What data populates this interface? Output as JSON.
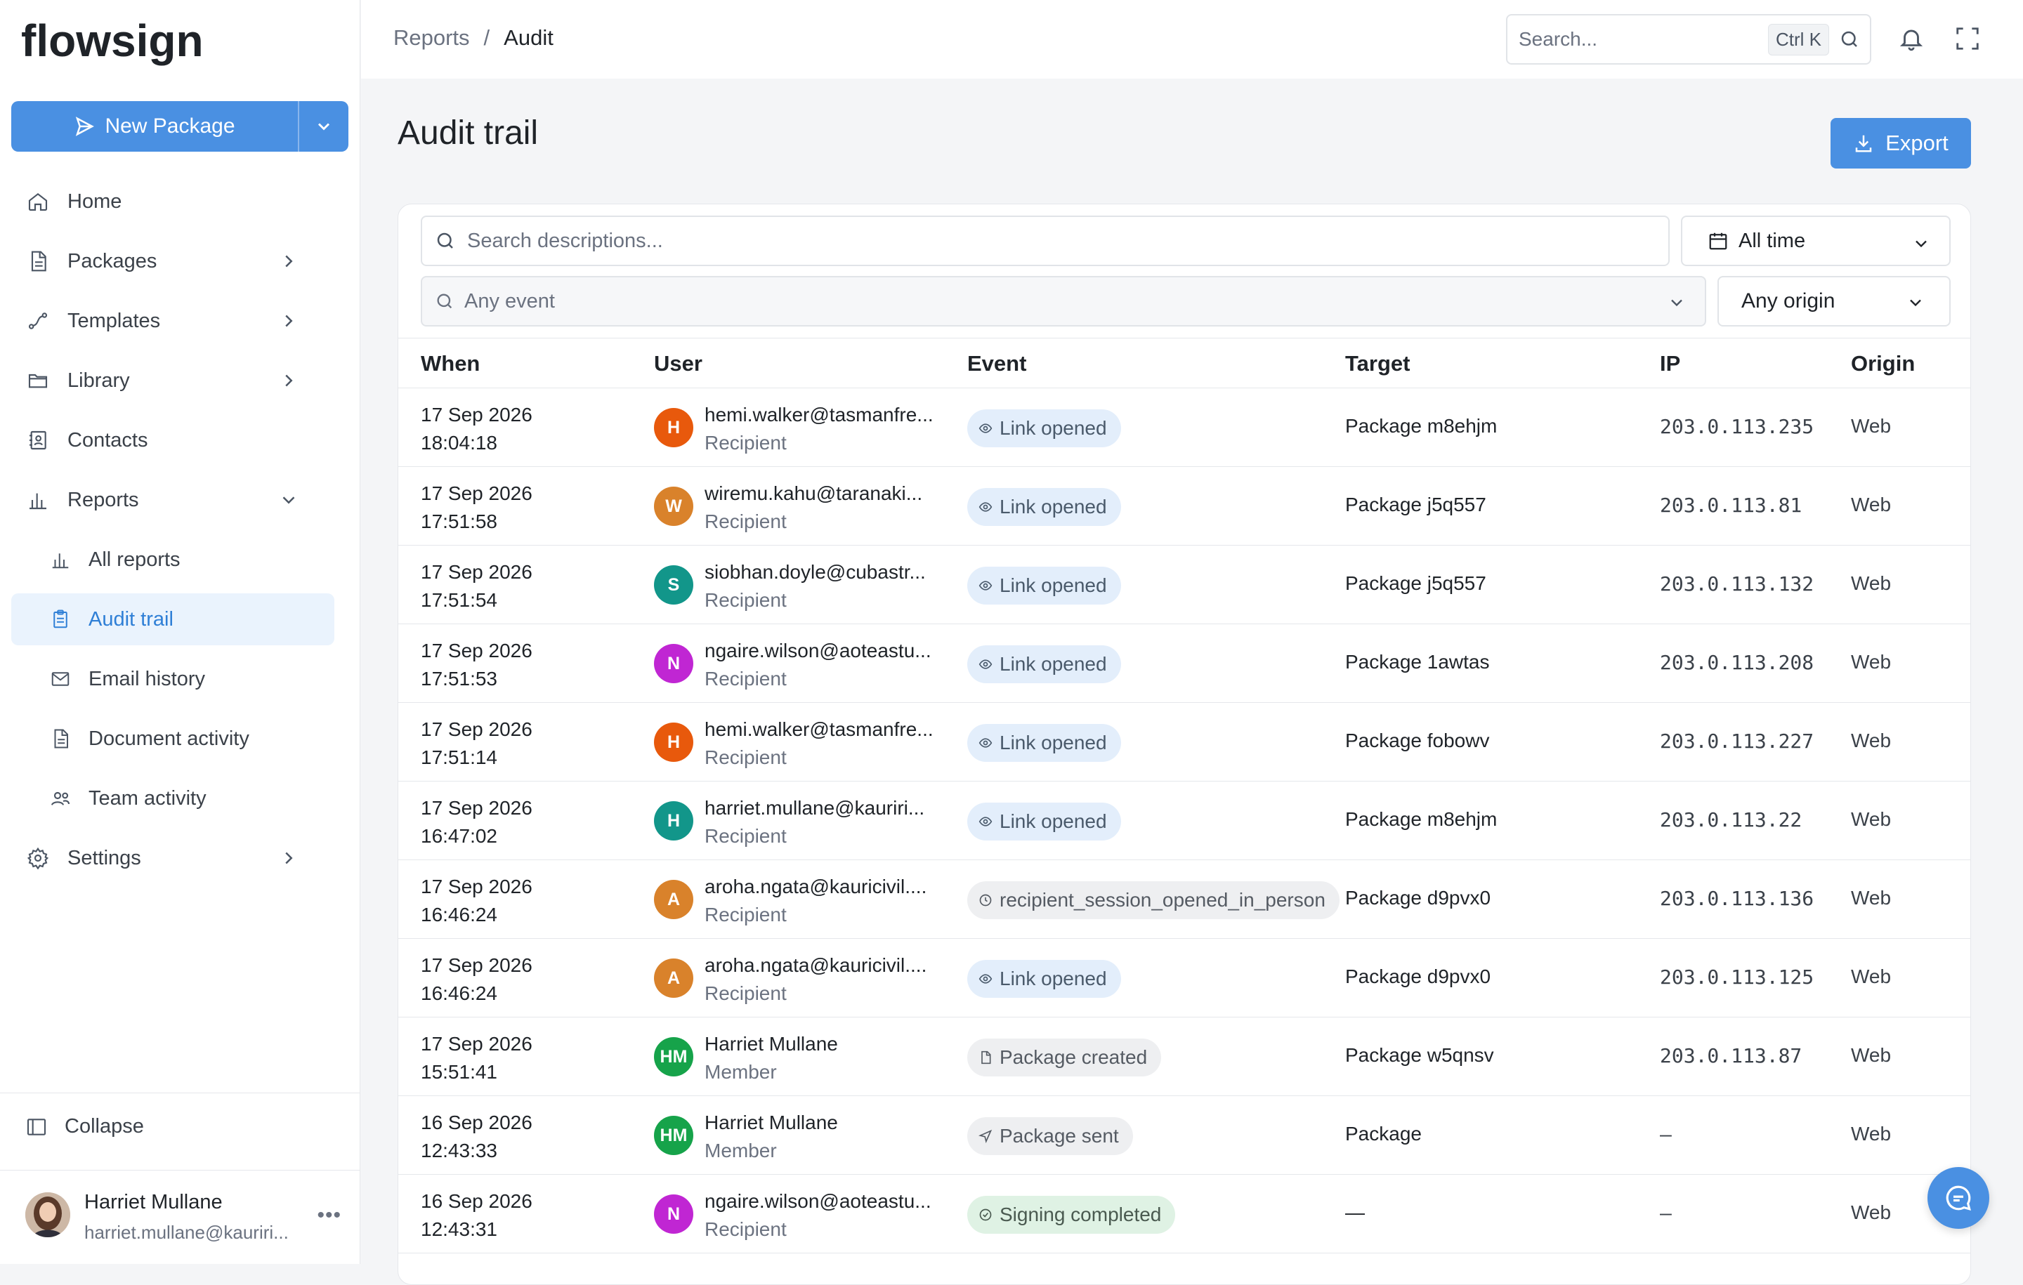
{
  "app": {
    "logo_text": "flowsign",
    "brand_color": "#4a90e2"
  },
  "sidebar": {
    "new_package_label": "New Package",
    "items": [
      {
        "label": "Home",
        "icon": "home-icon"
      },
      {
        "label": "Packages",
        "icon": "document-icon"
      },
      {
        "label": "Templates",
        "icon": "route-icon"
      },
      {
        "label": "Library",
        "icon": "folder-icon"
      },
      {
        "label": "Contacts",
        "icon": "contact-book-icon"
      },
      {
        "label": "Reports",
        "icon": "bar-chart-icon"
      },
      {
        "label": "All reports",
        "icon": "bar-chart-icon"
      },
      {
        "label": "Audit trail",
        "icon": "clipboard-icon"
      },
      {
        "label": "Email history",
        "icon": "mail-icon"
      },
      {
        "label": "Document activity",
        "icon": "document-icon"
      },
      {
        "label": "Team activity",
        "icon": "users-icon"
      },
      {
        "label": "Settings",
        "icon": "gear-icon"
      }
    ],
    "collapse_label": "Collapse",
    "user": {
      "name": "Harriet Mullane",
      "email": "harriet.mullane@kauriri..."
    }
  },
  "topbar": {
    "breadcrumb": [
      "Reports",
      "Audit"
    ],
    "search_placeholder": "Search...",
    "search_shortcut": "Ctrl K"
  },
  "main": {
    "title": "Audit trail",
    "export_label": "Export",
    "filters": {
      "search_placeholder": "Search descriptions...",
      "time_value": "All time",
      "event_placeholder": "Any event",
      "origin_value": "Any origin"
    },
    "columns": [
      "When",
      "User",
      "Event",
      "Target",
      "IP",
      "Origin"
    ],
    "rows": [
      {
        "date": "17 Sep 2026",
        "time": "18:04:18",
        "initials": "H",
        "avatar_color": "#e8590c",
        "user": "hemi.walker@tasmanfre...",
        "role": "Recipient",
        "event": "Link opened",
        "event_kind": "blue",
        "event_icon": "eye-icon",
        "target": "Package m8ehjm",
        "ip": "203.0.113.235",
        "origin": "Web"
      },
      {
        "date": "17 Sep 2026",
        "time": "17:51:58",
        "initials": "W",
        "avatar_color": "#d9822b",
        "user": "wiremu.kahu@taranaki...",
        "role": "Recipient",
        "event": "Link opened",
        "event_kind": "blue",
        "event_icon": "eye-icon",
        "target": "Package j5q557",
        "ip": "203.0.113.81",
        "origin": "Web"
      },
      {
        "date": "17 Sep 2026",
        "time": "17:51:54",
        "initials": "S",
        "avatar_color": "#12968a",
        "user": "siobhan.doyle@cubastr...",
        "role": "Recipient",
        "event": "Link opened",
        "event_kind": "blue",
        "event_icon": "eye-icon",
        "target": "Package j5q557",
        "ip": "203.0.113.132",
        "origin": "Web"
      },
      {
        "date": "17 Sep 2026",
        "time": "17:51:53",
        "initials": "N",
        "avatar_color": "#c026d3",
        "user": "ngaire.wilson@aoteastu...",
        "role": "Recipient",
        "event": "Link opened",
        "event_kind": "blue",
        "event_icon": "eye-icon",
        "target": "Package 1awtas",
        "ip": "203.0.113.208",
        "origin": "Web"
      },
      {
        "date": "17 Sep 2026",
        "time": "17:51:14",
        "initials": "H",
        "avatar_color": "#e8590c",
        "user": "hemi.walker@tasmanfre...",
        "role": "Recipient",
        "event": "Link opened",
        "event_kind": "blue",
        "event_icon": "eye-icon",
        "target": "Package fobowv",
        "ip": "203.0.113.227",
        "origin": "Web"
      },
      {
        "date": "17 Sep 2026",
        "time": "16:47:02",
        "initials": "H",
        "avatar_color": "#12968a",
        "user": "harriet.mullane@kauriri...",
        "role": "Recipient",
        "event": "Link opened",
        "event_kind": "blue",
        "event_icon": "eye-icon",
        "target": "Package m8ehjm",
        "ip": "203.0.113.22",
        "origin": "Web"
      },
      {
        "date": "17 Sep 2026",
        "time": "16:46:24",
        "initials": "A",
        "avatar_color": "#d9822b",
        "user": "aroha.ngata@kauricivil....",
        "role": "Recipient",
        "event": "recipient_session_opened_in_person",
        "event_kind": "gray",
        "event_icon": "clock-icon",
        "target": "Package d9pvx0",
        "ip": "203.0.113.136",
        "origin": "Web"
      },
      {
        "date": "17 Sep 2026",
        "time": "16:46:24",
        "initials": "A",
        "avatar_color": "#d9822b",
        "user": "aroha.ngata@kauricivil....",
        "role": "Recipient",
        "event": "Link opened",
        "event_kind": "blue",
        "event_icon": "eye-icon",
        "target": "Package d9pvx0",
        "ip": "203.0.113.125",
        "origin": "Web"
      },
      {
        "date": "17 Sep 2026",
        "time": "15:51:41",
        "initials": "HM",
        "avatar_color": "#16a34a",
        "user": "Harriet Mullane",
        "role": "Member",
        "event": "Package created",
        "event_kind": "gray",
        "event_icon": "document-icon",
        "target": "Package w5qnsv",
        "ip": "203.0.113.87",
        "origin": "Web"
      },
      {
        "date": "16 Sep 2026",
        "time": "12:43:33",
        "initials": "HM",
        "avatar_color": "#16a34a",
        "user": "Harriet Mullane",
        "role": "Member",
        "event": "Package sent",
        "event_kind": "gray",
        "event_icon": "send-icon",
        "target": "Package",
        "ip": "—",
        "origin": "Web"
      },
      {
        "date": "16 Sep 2026",
        "time": "12:43:31",
        "initials": "N",
        "avatar_color": "#c026d3",
        "user": "ngaire.wilson@aoteastu...",
        "role": "Recipient",
        "event": "Signing completed",
        "event_kind": "green",
        "event_icon": "check-circle-icon",
        "target": "—",
        "ip": "—",
        "origin": "Web"
      }
    ]
  }
}
